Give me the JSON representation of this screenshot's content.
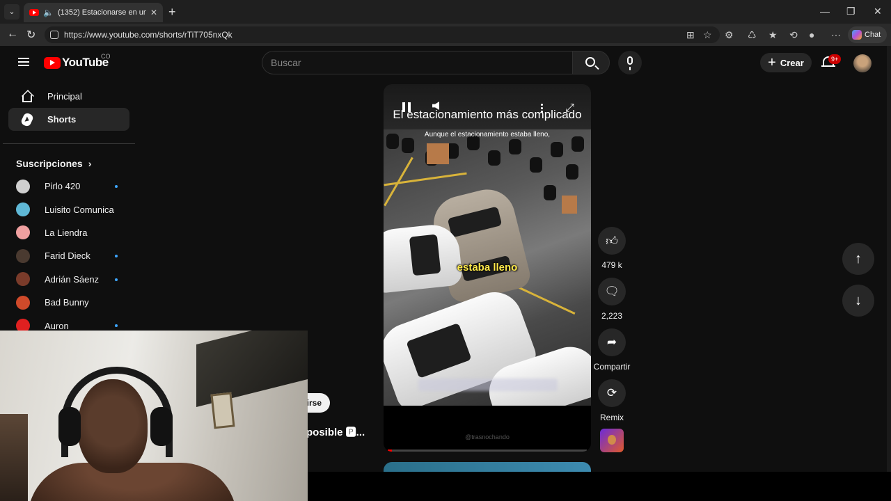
{
  "browser": {
    "tab_title": "(1352) Estacionarse en un lug",
    "url": "https://www.youtube.com/shorts/rTiT705nxQk",
    "chat_label": "Chat"
  },
  "header": {
    "logo_text": "YouTube",
    "country_code": "CO",
    "search_placeholder": "Buscar",
    "create_label": "Crear",
    "notification_count": "9+"
  },
  "sidebar": {
    "items": [
      {
        "label": "Principal",
        "icon": "home-icon"
      },
      {
        "label": "Shorts",
        "icon": "shorts-icon"
      }
    ],
    "subscriptions_title": "Suscripciones",
    "subscriptions": [
      {
        "name": "Pirlo 420",
        "new": true,
        "color": "#cfcfcf"
      },
      {
        "name": "Luisito Comunica",
        "new": false,
        "color": "#5fb8d6"
      },
      {
        "name": "La Liendra",
        "new": false,
        "color": "#f0a0a0"
      },
      {
        "name": "Farid Dieck",
        "new": true,
        "color": "#4a3a30"
      },
      {
        "name": "Adrián Sáenz",
        "new": true,
        "color": "#7a3b2a"
      },
      {
        "name": "Bad Bunny",
        "new": false,
        "color": "#d04a2a"
      },
      {
        "name": "Auron",
        "new": true,
        "color": "#e02020"
      }
    ]
  },
  "short": {
    "overlay_title": "El estacionamiento más complicado",
    "overlay_subtitle": "Aunque el estacionamiento estaba lleno,",
    "caption": "estaba lleno",
    "watermark": "@trasnochando",
    "progress_fraction": 0.02,
    "partial_subscribe": "irse",
    "partial_title": "posible 🅿..."
  },
  "actions": {
    "like_count": "479 k",
    "comment_count": "2,223",
    "share_label": "Compartir",
    "remix_label": "Remix"
  },
  "colors": {
    "accent": "#ff0000",
    "caption": "#ffe94a",
    "new_dot": "#3ea6ff"
  }
}
